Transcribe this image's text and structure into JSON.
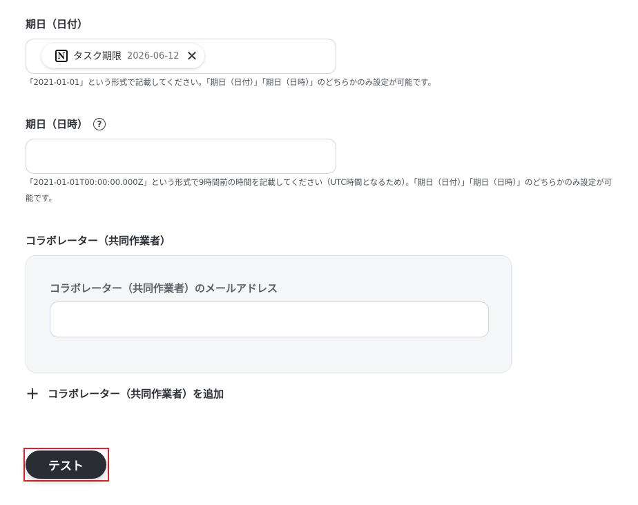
{
  "due_date": {
    "label": "期日（日付）",
    "chip": {
      "icon": "notion-icon",
      "name": "タスク期限",
      "value": "2026-06-12"
    },
    "hint": "「2021-01-01」という形式で記載してください。「期日（日付）」「期日（日時）」のどちらかのみ設定が可能です。"
  },
  "due_datetime": {
    "label": "期日（日時）",
    "help_icon": "?",
    "value": "",
    "hint": "「2021-01-01T00:00:00.000Z」という形式で9時間前の時間を記載してください（UTC時間となるため）。「期日（日付）」「期日（日時）」のどちらかのみ設定が可能です。"
  },
  "collaborators": {
    "label": "コラボレーター（共同作業者）",
    "email_label": "コラボレーター（共同作業者）のメールアドレス",
    "email_value": "",
    "add_label": "コラボレーター（共同作業者）を追加"
  },
  "test_button": {
    "label": "テスト",
    "highlight_color": "#e0202a"
  }
}
